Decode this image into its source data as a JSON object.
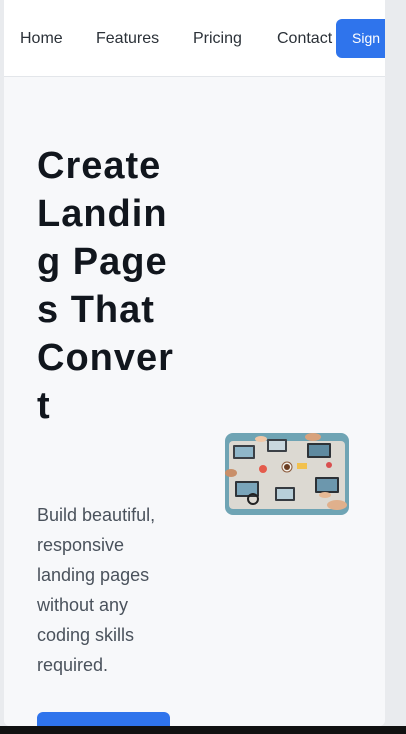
{
  "nav": {
    "links": [
      "Home",
      "Features",
      "Pricing",
      "Contact"
    ],
    "cta_label": "Sign"
  },
  "hero": {
    "title": "Create Landing Pages That Convert",
    "description": "Build beautiful, responsive landing pages without any coding skills required.",
    "image_alt": "Team working at laptops on a shared desk"
  },
  "colors": {
    "accent": "#2f74ec",
    "hero_background": "#f7f8fa",
    "title_text": "#11161d",
    "body_text": "#4a525c"
  }
}
